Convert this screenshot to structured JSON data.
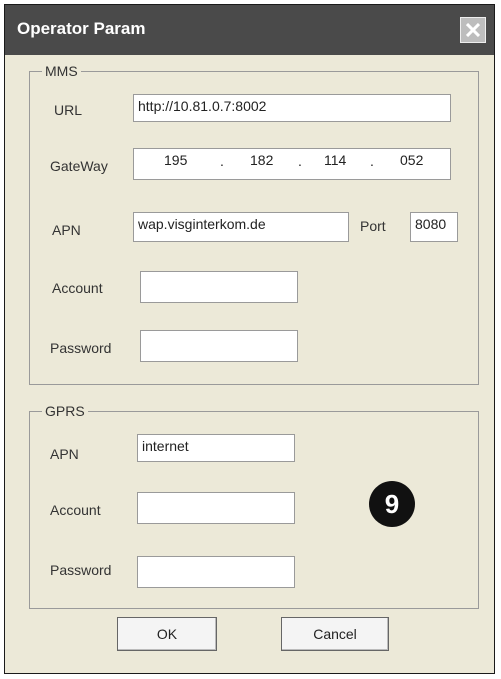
{
  "window": {
    "title": "Operator Param"
  },
  "mms": {
    "group_label": "MMS",
    "url_label": "URL",
    "url_value": "http://10.81.0.7:8002",
    "gateway_label": "GateWay",
    "gateway_parts": [
      "195",
      "182",
      "114",
      "052"
    ],
    "gateway_dot": ".",
    "apn_label": "APN",
    "apn_value": "wap.visɡinterkom.de",
    "port_label": "Port",
    "port_value": "8080",
    "account_label": "Account",
    "account_value": "",
    "password_label": "Password",
    "password_value": ""
  },
  "gprs": {
    "group_label": "GPRS",
    "apn_label": "APN",
    "apn_value": "internet",
    "account_label": "Account",
    "account_value": "",
    "password_label": "Password",
    "password_value": ""
  },
  "annotation": {
    "number": "9"
  },
  "buttons": {
    "ok": "OK",
    "cancel": "Cancel"
  },
  "colors": {
    "titlebar": "#4a4a4a",
    "dialog_bg": "#ece9d8",
    "badge": "#111111"
  },
  "icons": {
    "close": "close-icon"
  }
}
